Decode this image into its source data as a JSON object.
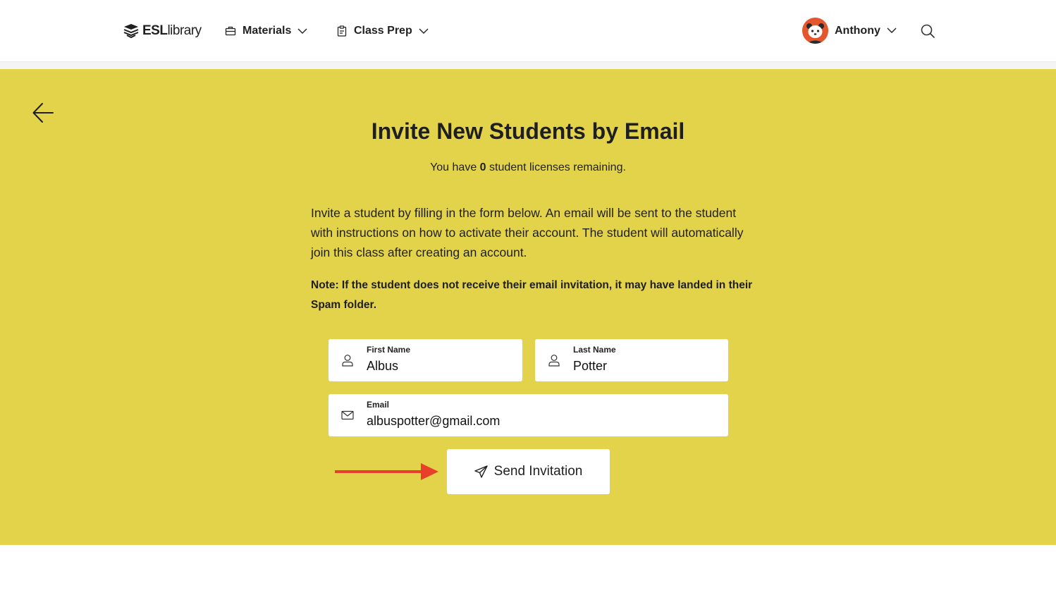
{
  "header": {
    "logo": {
      "brand_bold": "ESL",
      "brand_light": "library"
    },
    "nav": [
      {
        "label": "Materials",
        "icon": "briefcase-icon"
      },
      {
        "label": "Class Prep",
        "icon": "clipboard-icon"
      }
    ],
    "user": {
      "name": "Anthony",
      "avatar_color": "#e4572e"
    }
  },
  "page": {
    "title": "Invite New Students by Email",
    "licenses_prefix": "You have ",
    "licenses_count": "0",
    "licenses_suffix": " student licenses remaining.",
    "description": "Invite a student by filling in the form below. An email will be sent to the student with instructions on how to activate their account. The student will automatically join this class after creating an account.",
    "note": "Note: If the student does not receive their email invitation, it may have landed in their Spam folder."
  },
  "form": {
    "first_name": {
      "label": "First Name",
      "value": "Albus"
    },
    "last_name": {
      "label": "Last Name",
      "value": "Potter"
    },
    "email": {
      "label": "Email",
      "value": "albuspotter@gmail.com"
    },
    "submit_label": "Send Invitation"
  },
  "colors": {
    "panel": "#e3d34b",
    "annotation_arrow": "#e8402a"
  }
}
